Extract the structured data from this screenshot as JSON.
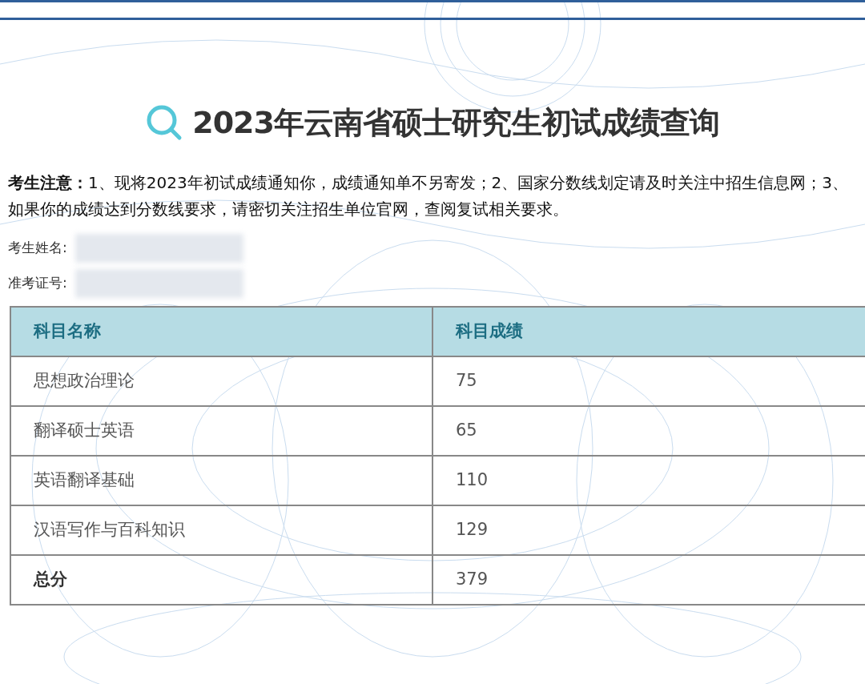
{
  "title": "2023年云南省硕士研究生初试成绩查询",
  "notice": "**考生注意：**1、现将2023年初试成绩通知你，成绩通知单不另寄发；2、国家分数线划定请及时关注中招生信息网；3、如果你的成绩达到分数线要求，请密切关注招生单位官网，查阅复试相关要求。",
  "fields": [
    {
      "label": "考生姓名:"
    },
    {
      "label": "准考证号:"
    }
  ],
  "table": {
    "columns": [
      "科目名称",
      "科目成绩"
    ],
    "rows": [
      {
        "kind": "subject",
        "cells": [
          "思想政治理论",
          "75"
        ]
      },
      {
        "kind": "subject",
        "cells": [
          "翻译硕士英语",
          "65"
        ]
      },
      {
        "kind": "subject",
        "cells": [
          "英语翻译基础",
          "110"
        ]
      },
      {
        "kind": "subject",
        "cells": [
          "汉语写作与百科知识",
          "129"
        ]
      },
      {
        "kind": "total",
        "cells": [
          "总分",
          "379"
        ]
      }
    ]
  }
}
